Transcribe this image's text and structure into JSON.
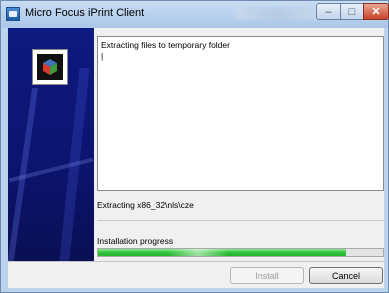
{
  "window": {
    "title": "Micro Focus iPrint Client"
  },
  "log": {
    "lines": "Extracting files to temporary folder\n|"
  },
  "status": {
    "current_action": "Extracting x86_32\\nls\\cze"
  },
  "progress": {
    "label": "Installation progress",
    "fraction": 0.87
  },
  "buttons": {
    "install_label": "Install",
    "cancel_label": "Cancel"
  },
  "colors": {
    "banner": "#0f1a80",
    "progress_fill": "#2fc33a"
  },
  "icons": {
    "title": "printer-app-icon",
    "banner_logo": "micro-focus-cube-logo"
  }
}
